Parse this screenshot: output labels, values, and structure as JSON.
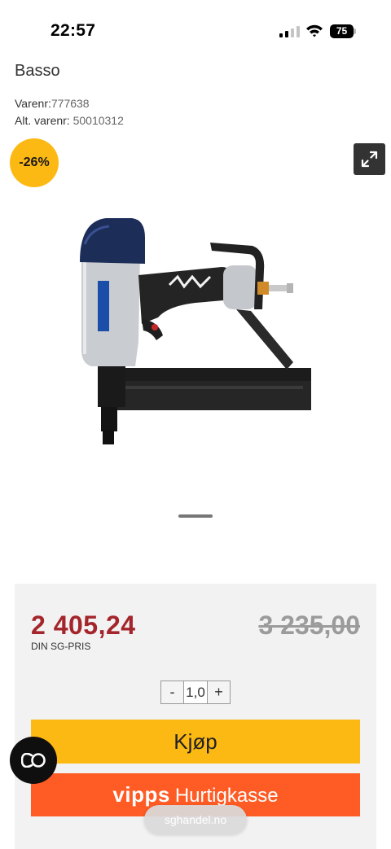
{
  "status_bar": {
    "time": "22:57",
    "battery": "75",
    "icons": [
      "signal-icon",
      "wifi-icon",
      "battery-icon"
    ]
  },
  "product": {
    "brand": "Basso",
    "sku_label": "Varenr:",
    "sku": "777638",
    "alt_sku_label": "Alt. varenr:",
    "alt_sku": "50010312",
    "discount_badge": "-26%",
    "image_name": "pneumatic-nailer-image"
  },
  "gallery": {
    "expand_icon": "expand-icon"
  },
  "pricing": {
    "price": "2 405,24",
    "price_label": "DIN SG-PRIS",
    "old_price": "3 235,00"
  },
  "quantity": {
    "minus": "-",
    "value": "1,0",
    "plus": "+"
  },
  "actions": {
    "buy_label": "Kjøp",
    "vipps_logo": "vipps",
    "vipps_label": "Hurtigkasse"
  },
  "browser": {
    "url": "sghandel.no"
  },
  "colors": {
    "badge": "#fdb913",
    "price": "#a4262c",
    "buy_button": "#fdb913",
    "vipps_button": "#ff5b24"
  }
}
